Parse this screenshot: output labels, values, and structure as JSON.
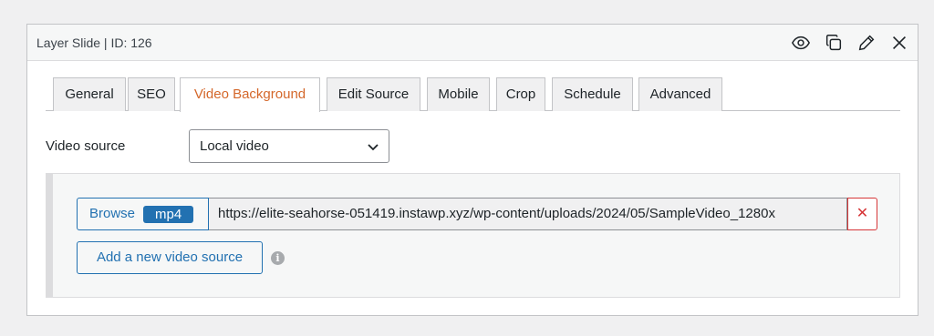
{
  "panel": {
    "title": "Layer Slide | ID: 126",
    "header_icons": [
      "eye-icon",
      "duplicate-icon",
      "pencil-icon",
      "close-icon"
    ]
  },
  "tabs": [
    {
      "label": "General",
      "active": false
    },
    {
      "label": "SEO",
      "active": false
    },
    {
      "label": "Video Background",
      "active": true
    },
    {
      "label": "Edit Source",
      "active": false
    },
    {
      "label": "Mobile",
      "active": false
    },
    {
      "label": "Crop",
      "active": false
    },
    {
      "label": "Schedule",
      "active": false
    },
    {
      "label": "Advanced",
      "active": false
    }
  ],
  "video_source": {
    "label": "Video source",
    "selected": "Local video"
  },
  "source_row": {
    "browse_label": "Browse",
    "format_badge": "mp4",
    "url": "https://elite-seahorse-051419.instawp.xyz/wp-content/uploads/2024/05/SampleVideo_1280x",
    "remove_glyph": "✕"
  },
  "add_source_label": "Add a new video source",
  "info_glyph": "i",
  "colors": {
    "accent": "#2271b1",
    "active_tab": "#d4672a",
    "danger": "#d63638"
  }
}
